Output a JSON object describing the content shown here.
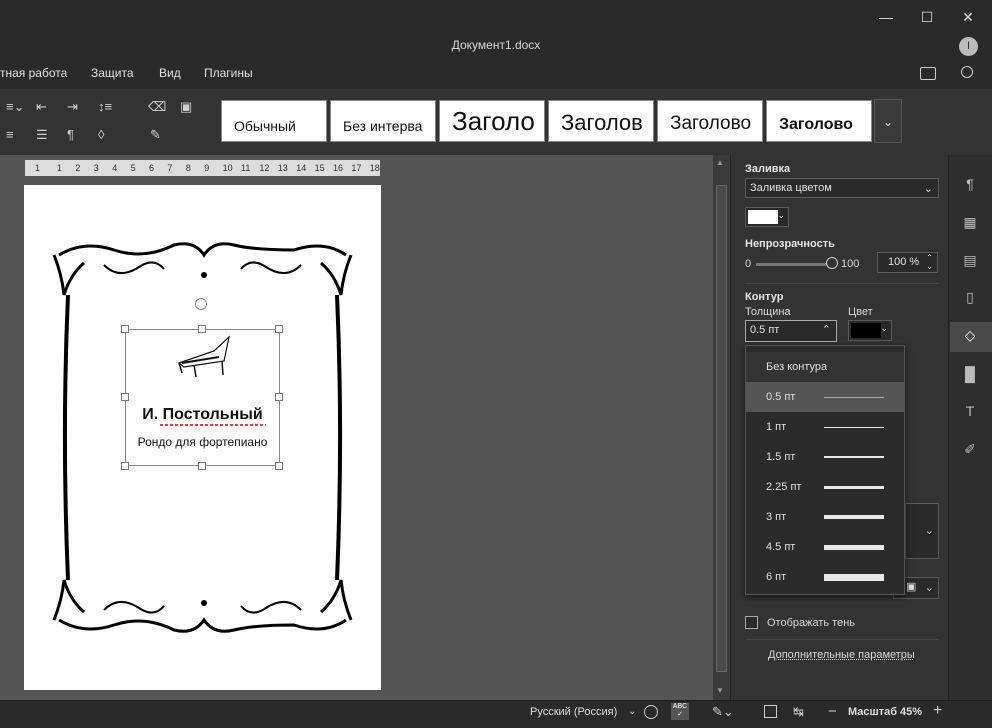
{
  "window": {
    "title": "Документ1.docx",
    "user_initial": "I"
  },
  "menu": [
    "тная работа",
    "Защита",
    "Вид",
    "Плагины"
  ],
  "styles": [
    "Обычный",
    "Без интерва",
    "Заголо",
    "Заголов",
    "Заголово",
    "Заголово"
  ],
  "ruler": {
    "ticks": [
      "1",
      "1",
      "2",
      "3",
      "4",
      "5",
      "6",
      "7",
      "8",
      "9",
      "10",
      "11",
      "12",
      "13",
      "14",
      "15",
      "16",
      "17",
      "18"
    ]
  },
  "document": {
    "author": "И. Постольный",
    "subtitle": "Рондо для фортепиано"
  },
  "panel": {
    "fill_title": "Заливка",
    "fill_type": "Заливка цветом",
    "fill_color": "#ffffff",
    "opacity_title": "Непрозрачность",
    "opacity_min": "0",
    "opacity_max": "100",
    "opacity_value": "100 %",
    "opacity_level": 1.0,
    "stroke_title": "Контур",
    "thickness_label": "Толщина",
    "thickness_value": "0.5 пт",
    "color_label": "Цвет",
    "stroke_color": "#000000",
    "show_shadow": "Отображать тень",
    "advanced": "Дополнительные параметры"
  },
  "dropdown": {
    "items": [
      {
        "label": "Без контура",
        "weight": 0
      },
      {
        "label": "0.5 пт",
        "weight": 0.5,
        "selected": true
      },
      {
        "label": "1 пт",
        "weight": 1
      },
      {
        "label": "1.5 пт",
        "weight": 1.5
      },
      {
        "label": "2.25 пт",
        "weight": 2.25
      },
      {
        "label": "3 пт",
        "weight": 3
      },
      {
        "label": "4.5 пт",
        "weight": 4.5
      },
      {
        "label": "6 пт",
        "weight": 6
      }
    ]
  },
  "statusbar": {
    "language": "Русский (Россия)",
    "zoom": "Масштаб 45%"
  },
  "colors": {
    "accent": "#555555",
    "selected_item": "#555555"
  }
}
